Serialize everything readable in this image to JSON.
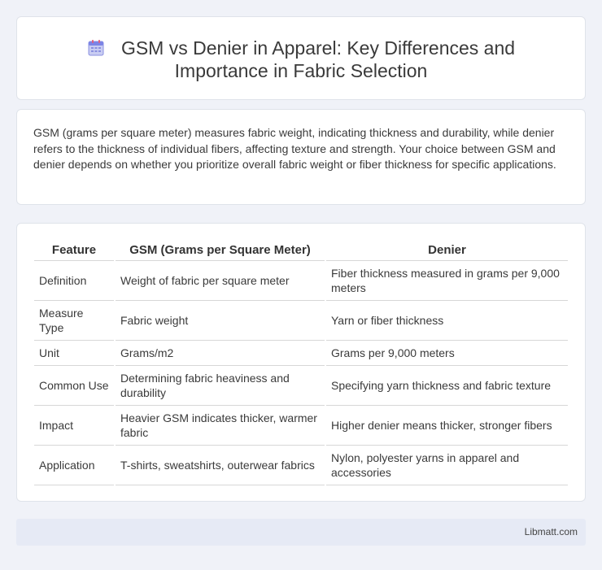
{
  "header": {
    "title_line1": "GSM vs Denier in Apparel: Key Differences and",
    "title_line2": "Importance in Fabric Selection",
    "icon": "calendar-icon"
  },
  "summary": {
    "text": "GSM (grams per square meter) measures fabric weight, indicating thickness and durability, while denier refers to the thickness of individual fibers, affecting texture and strength. Your choice between GSM and denier depends on whether you prioritize overall fabric weight or fiber thickness for specific applications."
  },
  "table": {
    "headers": [
      "Feature",
      "GSM (Grams per Square Meter)",
      "Denier"
    ],
    "rows": [
      [
        "Definition",
        "Weight of fabric per square meter",
        "Fiber thickness measured in grams per 9,000 meters"
      ],
      [
        "Measure Type",
        "Fabric weight",
        "Yarn or fiber thickness"
      ],
      [
        "Unit",
        "Grams/m2",
        "Grams per 9,000 meters"
      ],
      [
        "Common Use",
        "Determining fabric heaviness and durability",
        "Specifying yarn thickness and fabric texture"
      ],
      [
        "Impact",
        "Heavier GSM indicates thicker, warmer fabric",
        "Higher denier means thicker, stronger fibers"
      ],
      [
        "Application",
        "T-shirts, sweatshirts, outerwear fabrics",
        "Nylon, polyester yarns in apparel and accessories"
      ]
    ]
  },
  "footer": {
    "site": "Libmatt.com"
  }
}
